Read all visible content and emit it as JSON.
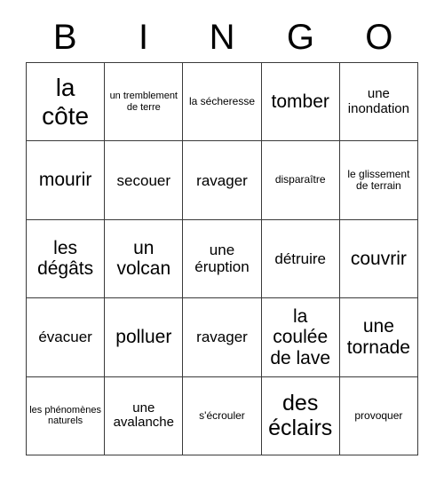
{
  "card": {
    "header_letters": [
      "B",
      "I",
      "N",
      "G",
      "O"
    ],
    "border_color": "#3a3a3a",
    "background_color": "#ffffff",
    "text_color": "#000000",
    "rows": 5,
    "columns": 5,
    "cells": [
      {
        "text": "la côte",
        "size": "xl"
      },
      {
        "text": "un tremblement de terre",
        "size": "tiny"
      },
      {
        "text": "la sécheresse",
        "size": "xxs"
      },
      {
        "text": "tomber",
        "size": "md"
      },
      {
        "text": "une inondation",
        "size": "xs"
      },
      {
        "text": "mourir",
        "size": "md"
      },
      {
        "text": "secouer",
        "size": "sm"
      },
      {
        "text": "ravager",
        "size": "sm"
      },
      {
        "text": "disparaître",
        "size": "xxs"
      },
      {
        "text": "le glissement de terrain",
        "size": "xxs"
      },
      {
        "text": "les dégâts",
        "size": "md"
      },
      {
        "text": "un volcan",
        "size": "md"
      },
      {
        "text": "une éruption",
        "size": "sm"
      },
      {
        "text": "détruire",
        "size": "sm"
      },
      {
        "text": "couvrir",
        "size": "md"
      },
      {
        "text": "évacuer",
        "size": "sm"
      },
      {
        "text": "polluer",
        "size": "md"
      },
      {
        "text": "ravager",
        "size": "sm"
      },
      {
        "text": "la coulée de lave",
        "size": "md"
      },
      {
        "text": "une tornade",
        "size": "md"
      },
      {
        "text": "les phénomènes naturels",
        "size": "tiny"
      },
      {
        "text": "une avalanche",
        "size": "xs"
      },
      {
        "text": "s'écrouler",
        "size": "xxs"
      },
      {
        "text": "des éclairs",
        "size": "lg"
      },
      {
        "text": "provoquer",
        "size": "xxs"
      }
    ]
  }
}
